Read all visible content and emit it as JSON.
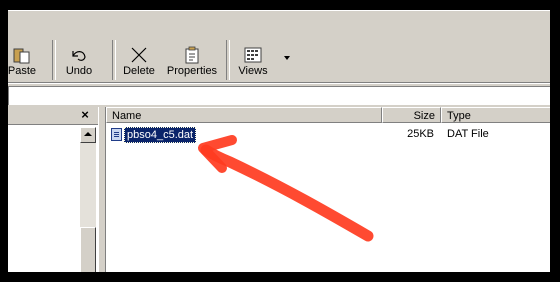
{
  "toolbar": {
    "buttons": [
      {
        "label": "Paste",
        "icon": "paste-icon"
      },
      {
        "label": "Undo",
        "icon": "undo-icon"
      },
      {
        "label": "Delete",
        "icon": "delete-icon"
      },
      {
        "label": "Properties",
        "icon": "properties-icon"
      },
      {
        "label": "Views",
        "icon": "views-icon"
      }
    ]
  },
  "left_pane": {
    "close_glyph": "×"
  },
  "columns": {
    "name": "Name",
    "size": "Size",
    "type": "Type"
  },
  "files": [
    {
      "name": "pbso4_c5.dat",
      "size": "25KB",
      "type": "DAT File"
    }
  ],
  "colors": {
    "selection": "#0a246a",
    "annotation_arrow": "#ff3b1f",
    "chrome": "#d4d0c8"
  }
}
